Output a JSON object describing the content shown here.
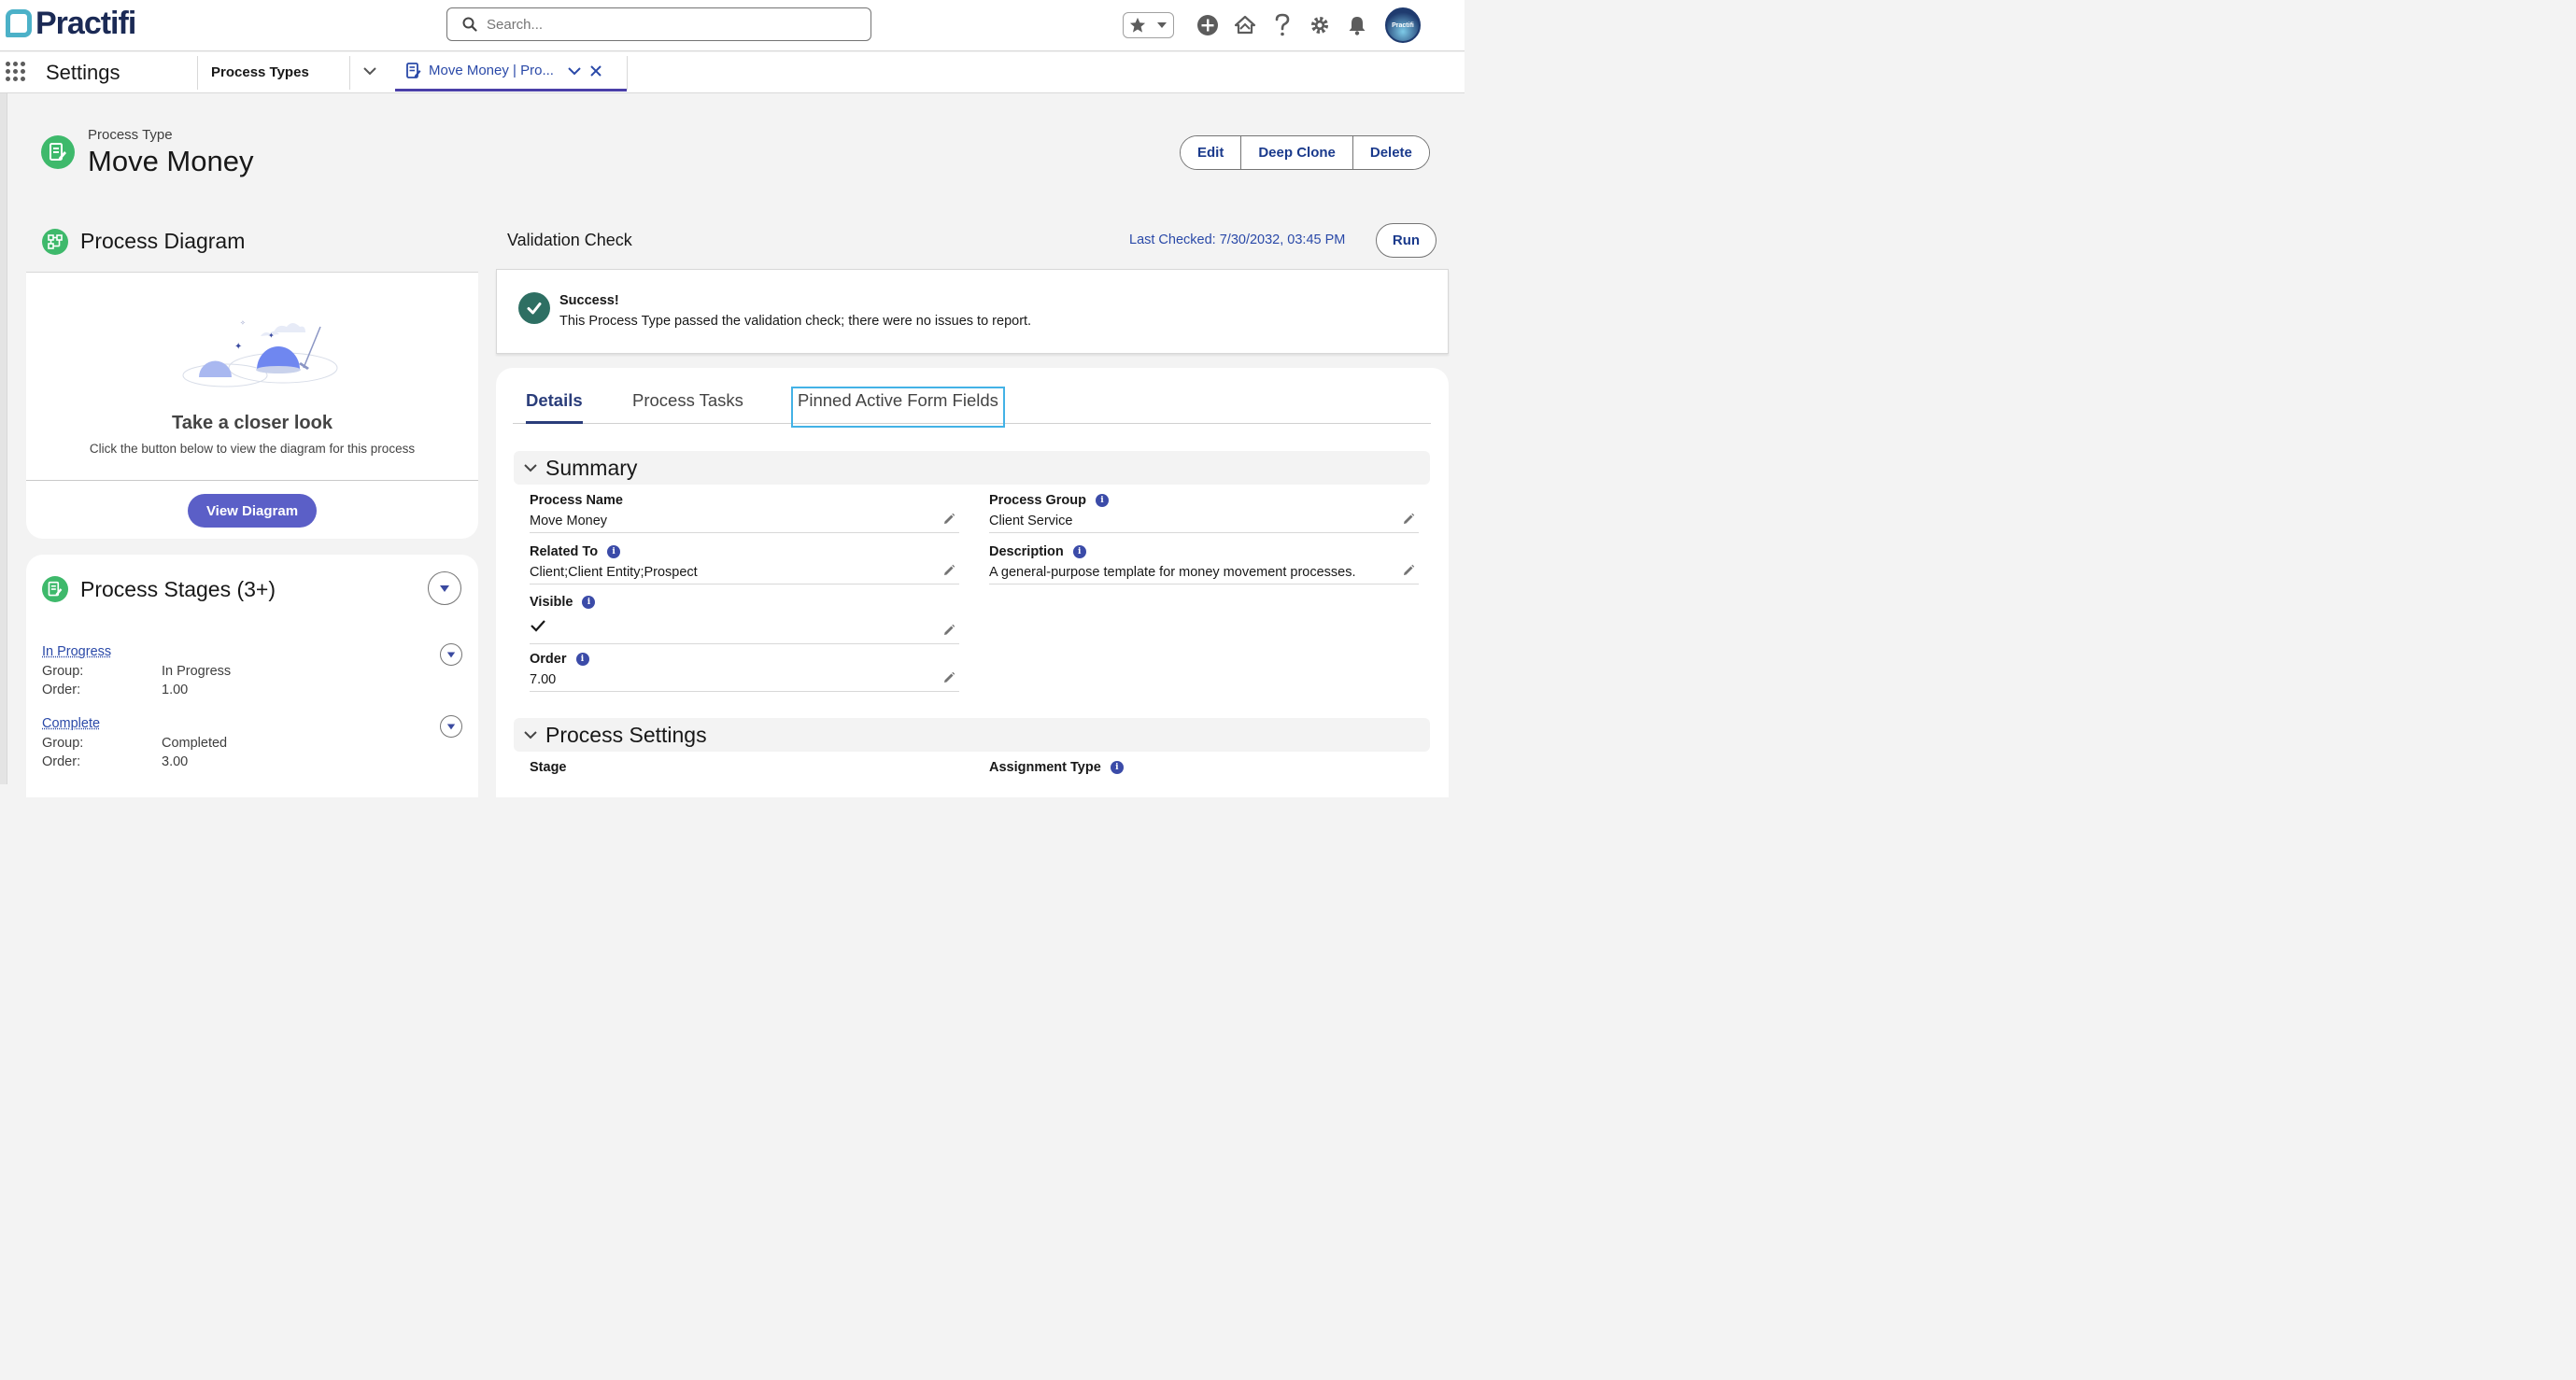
{
  "header": {
    "logo_text": "Practifi",
    "search_placeholder": "Search...",
    "avatar_text": "Practifi"
  },
  "nav": {
    "app_name": "Settings",
    "item": "Process Types",
    "tab_label": "Move Money | Pro..."
  },
  "record": {
    "type_label": "Process Type",
    "title": "Move Money",
    "actions": [
      "Edit",
      "Deep Clone",
      "Delete"
    ]
  },
  "diagram": {
    "title": "Process Diagram",
    "heading": "Take a closer look",
    "sub": "Click the button below to view the diagram for this process",
    "button": "View Diagram"
  },
  "stages": {
    "title": "Process Stages (3+)",
    "items": [
      {
        "name": "In Progress",
        "group_label": "Group:",
        "group": "In Progress",
        "order_label": "Order:",
        "order": "1.00"
      },
      {
        "name": "Complete",
        "group_label": "Group:",
        "group": "Completed",
        "order_label": "Order:",
        "order": "3.00"
      }
    ]
  },
  "validation": {
    "title": "Validation Check",
    "last_checked": "Last Checked: 7/30/2032, 03:45 PM",
    "run": "Run",
    "status_title": "Success!",
    "status_msg": "This Process Type passed the validation check; there were no issues to report."
  },
  "details": {
    "tabs": [
      "Details",
      "Process Tasks",
      "Pinned Active Form Fields"
    ],
    "summary_title": "Summary",
    "fields": {
      "process_name": {
        "label": "Process Name",
        "value": "Move Money"
      },
      "process_group": {
        "label": "Process Group",
        "value": "Client Service"
      },
      "related_to": {
        "label": "Related To",
        "value": "Client;Client Entity;Prospect"
      },
      "description": {
        "label": "Description",
        "value": "A general-purpose template for money movement processes."
      },
      "visible": {
        "label": "Visible",
        "value": true
      },
      "order": {
        "label": "Order",
        "value": "7.00"
      }
    },
    "settings_title": "Process Settings",
    "settings_fields": {
      "stage": {
        "label": "Stage"
      },
      "assignment_type": {
        "label": "Assignment Type"
      }
    }
  },
  "colors": {
    "brand_teal": "#4cb1c8",
    "brand_navy": "#1b2a55",
    "icon_green": "#3eb96b",
    "primary_button": "#5b5fc7",
    "link_blue": "#2a49a8",
    "success": "#2e6f63",
    "focus_outline": "#43b2e6"
  }
}
